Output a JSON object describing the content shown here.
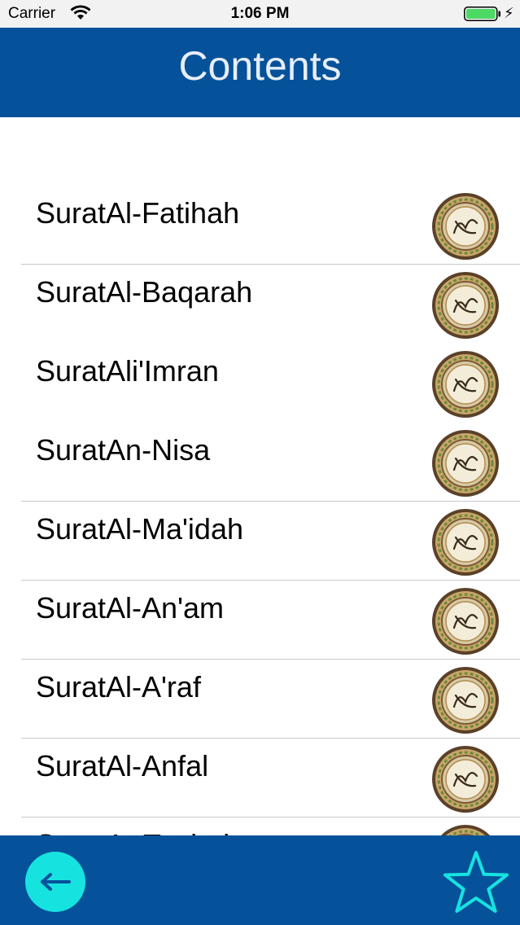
{
  "status_bar": {
    "carrier": "Carrier",
    "time": "1:06 PM",
    "battery_color": "#4cd964",
    "wifi_icon": "wifi-icon",
    "charging_icon": "bolt-icon"
  },
  "nav": {
    "title": "Contents",
    "background": "#06529a"
  },
  "list": {
    "items": [
      {
        "label": "SuratAl-Fatihah"
      },
      {
        "label": "SuratAl-Baqarah"
      },
      {
        "label": "SuratAli'Imran"
      },
      {
        "label": "SuratAn-Nisa"
      },
      {
        "label": "SuratAl-Ma'idah"
      },
      {
        "label": "SuratAl-An'am"
      },
      {
        "label": "SuratAl-A'raf"
      },
      {
        "label": "SuratAl-Anfal"
      },
      {
        "label": "SuratAt-Taubah"
      }
    ],
    "item_icon": "quran-medallion-icon"
  },
  "toolbar": {
    "back_icon": "left-arrow-icon",
    "back_color": "#16e3e0",
    "favorite_icon": "star-icon",
    "favorite_color": "#16e3e0"
  }
}
